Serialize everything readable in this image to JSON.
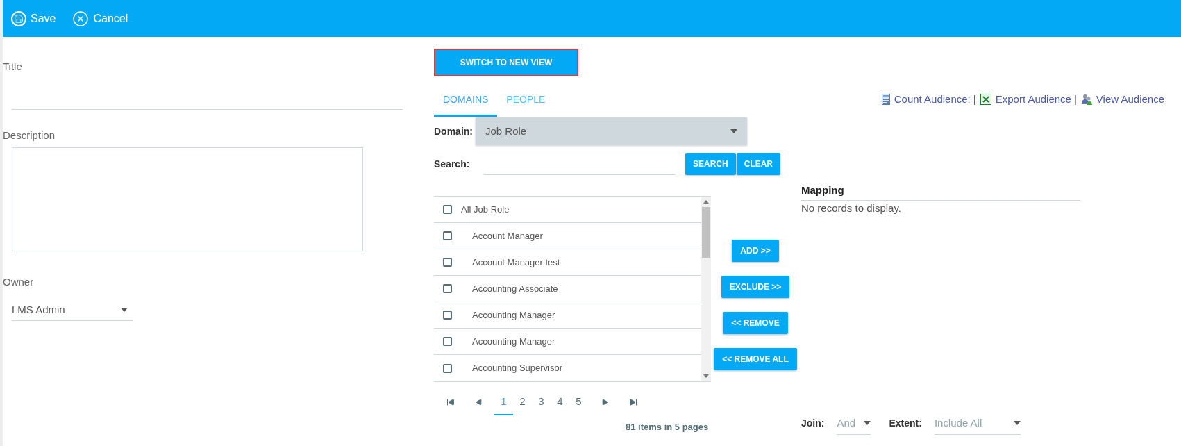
{
  "toolbar": [
    {
      "label": "Save",
      "kind": "save"
    },
    {
      "label": "Cancel",
      "kind": "cancel"
    }
  ],
  "form": {
    "title": {
      "label": "Title"
    },
    "description": {
      "label": "Description"
    },
    "owner": {
      "label": "Owner",
      "value": "LMS Admin"
    }
  },
  "switch_button": "SWITCH TO NEW VIEW",
  "tabs": [
    {
      "label": "DOMAINS",
      "selected": true
    },
    {
      "label": "PEOPLE",
      "selected": false
    }
  ],
  "audience_links": [
    {
      "label": "Count Audience:",
      "kind": "count",
      "separator_after": "|"
    },
    {
      "label": "Export Audience",
      "kind": "export",
      "separator_after": "|"
    },
    {
      "label": "View Audience",
      "kind": "view"
    }
  ],
  "domain": {
    "label": "Domain:",
    "value": "Job Role"
  },
  "search": {
    "label": "Search:",
    "buttons": [
      "SEARCH",
      "CLEAR"
    ]
  },
  "list": [
    {
      "label": "All Job Role",
      "checked": false,
      "children": [
        {
          "label": "Account Manager",
          "checked": false
        },
        {
          "label": "Account Manager test",
          "checked": false
        },
        {
          "label": "Accounting Associate",
          "checked": false
        },
        {
          "label": "Accounting Manager",
          "checked": false
        },
        {
          "label": "Accounting Manager",
          "checked": false
        },
        {
          "label": "Accounting Supervisor",
          "checked": false
        }
      ]
    }
  ],
  "action_buttons": [
    "ADD >>",
    "EXCLUDE >>",
    "<< REMOVE",
    "<< REMOVE ALL"
  ],
  "pagination": {
    "pages": [
      {
        "label": "1",
        "selected": true
      },
      {
        "label": "2",
        "selected": false
      },
      {
        "label": "3",
        "selected": false
      },
      {
        "label": "4",
        "selected": false
      },
      {
        "label": "5",
        "selected": false
      }
    ],
    "summary": "81 items in 5 pages"
  },
  "mapping": {
    "heading": "Mapping",
    "empty_text": "No records to display."
  },
  "join": {
    "label": "Join:",
    "value": "And"
  },
  "extent": {
    "label": "Extent:",
    "value": "Include All"
  }
}
